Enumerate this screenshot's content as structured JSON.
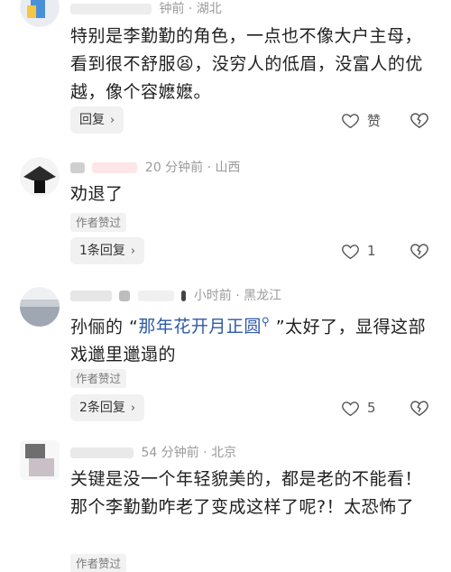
{
  "comments": [
    {
      "location_time": "钟前 · 湖北",
      "text_main": "特别是李勤勤的角色，一点也不像大户主母，看到很不舒服",
      "emoji": "😫",
      "text_tail": "，没穷人的低眉，没富人的优越，像个容嬷嬷。",
      "reply_label": "回复",
      "like_label": "赞"
    },
    {
      "location_time": "20 分钟前 · 山西",
      "text": "劝退了",
      "author_liked": "作者赞过",
      "reply_label": "1条回复",
      "like_count": "1"
    },
    {
      "location_time": "小时前 · 黑龙江",
      "text_before": "孙俪的 “",
      "text_highlight": "那年花开月正圆",
      "text_after": " ”太好了，显得这部戏邋里邋遢的",
      "author_liked": "作者赞过",
      "reply_label": "2条回复",
      "like_count": "5"
    },
    {
      "location_time": "54 分钟前 · 北京",
      "text": "关键是没一个年轻貌美的，都是老的不能看！那个李勤勤咋老了变成这样了呢?！太恐怖了",
      "author_liked": "作者赞过"
    }
  ],
  "colors": {
    "link_blue": "#2e59a8",
    "meta_gray": "#9a9a9a",
    "pill_bg": "#f1f1f1"
  }
}
